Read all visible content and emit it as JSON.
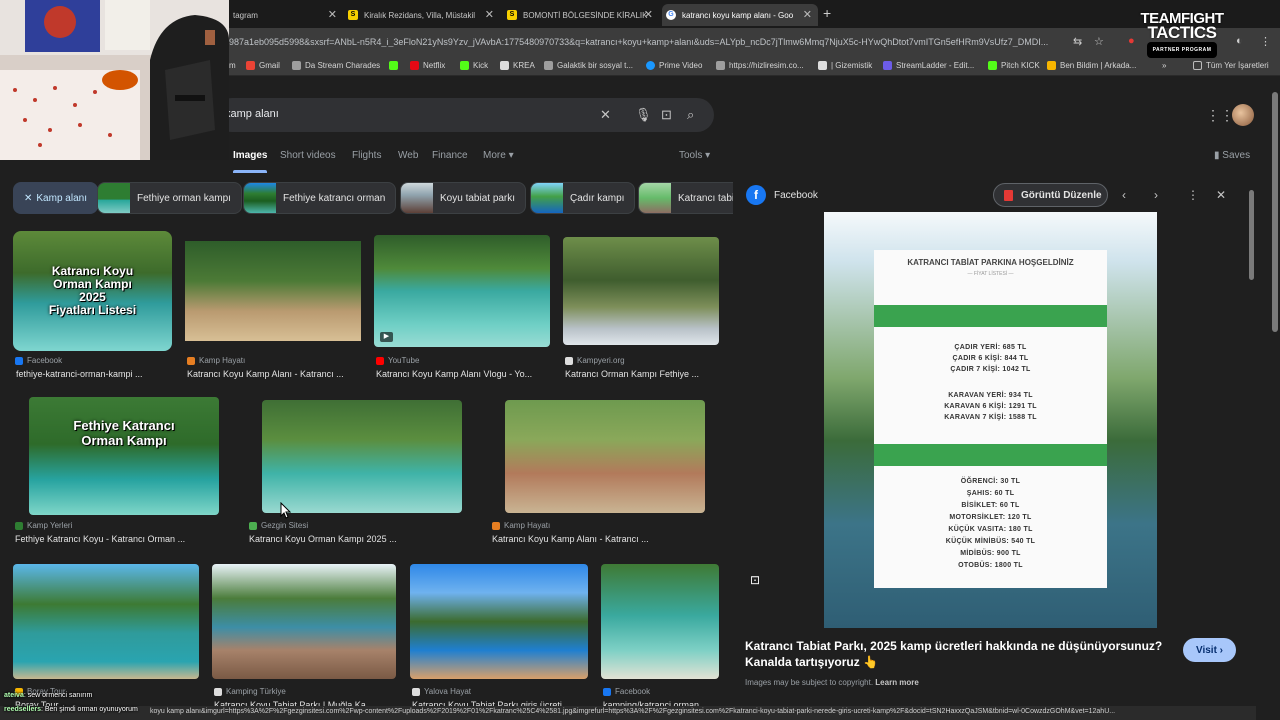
{
  "tabs": [
    {
      "label": "tagram",
      "active": false
    },
    {
      "label": "Kiralık Rezidans, Villa, Müstakil",
      "active": false
    },
    {
      "label": "BOMONTİ BÖLGESİNDE KİRALIK",
      "active": false
    },
    {
      "label": "katrancı koyu kamp alanı - Goo",
      "active": true
    }
  ],
  "address_bar": {
    "url": "987a1eb095d5998&sxsrf=ANbL-n5R4_i_3eFloN21yNs9Yzv_jVAvbA:1775480970733&q=katrancı+koyu+kamp+alanı&uds=ALYpb_ncDc7jTlmw6Mmq7NjuX5c-HYwQhDtot7vmITGn5efHRm9VsUfz7_DMDI..."
  },
  "bookmarks": [
    {
      "label": "m",
      "color": "#c13584"
    },
    {
      "label": "Gmail",
      "color": "#ea4335"
    },
    {
      "label": "Da Stream Charades",
      "color": "#9e9e9e"
    },
    {
      "label": "",
      "color": "#53fc18"
    },
    {
      "label": "Netflix",
      "color": "#e50914"
    },
    {
      "label": "Kick",
      "color": "#53fc18"
    },
    {
      "label": "KREA",
      "color": "#dddddd"
    },
    {
      "label": "Galaktik bir sosyal t...",
      "color": "#9e9e9e"
    },
    {
      "label": "Prime Video",
      "color": "#1a98ff"
    },
    {
      "label": "https://hizliresim.co...",
      "color": "#9e9e9e"
    },
    {
      "label": "| Gizemistik",
      "color": "#dddddd"
    },
    {
      "label": "StreamLadder - Edit...",
      "color": "#6c5ce7"
    },
    {
      "label": "Pitch KICK",
      "color": "#53fc18"
    },
    {
      "label": "Ben Bildim | Arkada...",
      "color": "#f7b500"
    },
    {
      "label": "Tüm Yer İşaretleri",
      "color": "#9e9e9e"
    }
  ],
  "search": {
    "query": "kamp alanı"
  },
  "nav_tabs": [
    "Images",
    "Short videos",
    "Flights",
    "Web",
    "Finance",
    "More",
    "Tools"
  ],
  "saves_label": "Saves",
  "chips": [
    {
      "label": "Kamp alanı",
      "selected": true
    },
    {
      "label": "Fethiye orman kampı",
      "selected": false
    },
    {
      "label": "Fethiye katrancı orman",
      "selected": false
    },
    {
      "label": "Koyu tabiat parkı",
      "selected": false
    },
    {
      "label": "Çadır kampı",
      "selected": false
    },
    {
      "label": "Katrancı tabi",
      "selected": false
    }
  ],
  "results": [
    {
      "source": "Facebook",
      "title": "fethiye-katranci-orman-kampi ...",
      "overlay": [
        "Katrancı Koyu",
        "Orman Kampı",
        "2025",
        "Fiyatları Listesi"
      ],
      "src_color": "#1877f2"
    },
    {
      "source": "Kamp Hayatı",
      "title": "Katrancı Koyu Kamp Alanı - Katrancı ...",
      "overlay": [],
      "src_color": "#e67e22"
    },
    {
      "source": "YouTube",
      "title": "Katrancı Koyu Kamp Alanı Vlogu - Yo...",
      "overlay": [],
      "src_color": "#ff0000"
    },
    {
      "source": "Kampyeri.org",
      "title": "Katrancı Orman Kampı Fethiye ...",
      "overlay": [],
      "src_color": "#dddddd"
    },
    {
      "source": "Kamp Yerleri",
      "title": "Fethiye Katrancı Koyu - Katrancı Orman ...",
      "overlay": [
        "Fethiye Katrancı",
        "Orman Kampı"
      ],
      "src_color": "#2e7d32"
    },
    {
      "source": "Gezgin Sitesi",
      "title": "Katrancı Koyu Orman Kampı 2025 ...",
      "overlay": [],
      "src_color": "#4caf50"
    },
    {
      "source": "Kamp Hayatı",
      "title": "Katrancı Koyu Kamp Alanı - Katrancı ...",
      "overlay": [],
      "src_color": "#e67e22"
    },
    {
      "source": "Boray Tour",
      "title": "Boray Tour",
      "overlay": [],
      "src_color": "#f7b500"
    },
    {
      "source": "Kamping Türkiye",
      "title": "Katrancı Koyu Tabiat Parkı | Muğla Ka...",
      "overlay": [],
      "src_color": "#dddddd"
    },
    {
      "source": "Yalova Hayat",
      "title": "Katrancı Koyu Tabiat Parkı giriş ücreti ...",
      "overlay": [],
      "src_color": "#dddddd"
    },
    {
      "source": "Facebook",
      "title": "kamping/katranci orman ...",
      "overlay": [],
      "src_color": "#1877f2"
    }
  ],
  "panel": {
    "source": "Facebook",
    "edit_label": "Görüntü Düzenle",
    "caption": "Katrancı Tabiat Parkı, 2025 kamp ücretleri hakkında ne düşünüyorsunuz? Kanalda tartışıyoruz 👆",
    "visit_label": "Visit",
    "copyright_text": "Images may be subject to copyright.",
    "learn_more": "Learn more",
    "price_card": {
      "heading": "KATRANCI TABİAT PARKINA HOŞGELDİNİZ",
      "subheading": "— FİYAT LİSTESİ —",
      "group1": [
        "ÇADIR YERİ: 685 TL",
        "ÇADIR 6 KİŞİ: 844 TL",
        "ÇADIR 7 KİŞİ: 1042 TL"
      ],
      "group2": [
        "KARAVAN YERİ: 934 TL",
        "KARAVAN 6 KİŞİ: 1291 TL",
        "KARAVAN 7 KİŞİ: 1588 TL"
      ],
      "group3": [
        "ÖĞRENCİ: 30 TL",
        "ŞAHIS: 60 TL",
        "BİSİKLET: 60 TL",
        "MOTORSİKLET: 120 TL",
        "KÜÇÜK VASITA: 180 TL",
        "KÜÇÜK MİNİBÜS: 540 TL",
        "MİDİBÜS: 900 TL",
        "OTOBÜS: 1800 TL"
      ]
    }
  },
  "status_url": "koyu kamp alanı&imgurl=https%3A%2F%2Fgezginsitesi.com%2Fwp-content%2Fuploads%2F2019%2F01%2Fkatranc%25C4%2581.jpg&imgrefurl=https%3A%2F%2Fgezginsitesi.com%2Fkatranci-koyu-tabiat-parki-nerede-giris-ucreti-kamp%2F&docid=tSN2HaxxzQaJSM&tbnid=wl-0CowzdzGOhM&vet=12ahU...",
  "overlay_logo": {
    "line1": "TEAMFIGHT",
    "line2": "TACTICS",
    "badge": "PARTNER PROGRAM"
  },
  "chat": [
    {
      "user": "ateiva",
      "message": ": sew ormenci sanırım"
    },
    {
      "user": "reedsellers",
      "message": ": Ben şimdi orman oyunuyorum"
    }
  ]
}
